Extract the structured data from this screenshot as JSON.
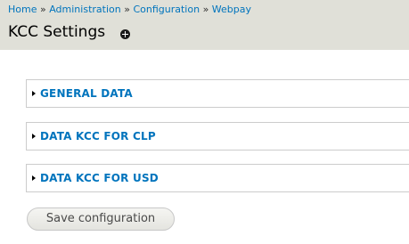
{
  "breadcrumb": {
    "items": [
      "Home",
      "Administration",
      "Configuration",
      "Webpay"
    ],
    "separator": "»"
  },
  "page_title": "KCC Settings",
  "shortcut_icon": "plus-circle-icon",
  "fieldsets": [
    {
      "label": "GENERAL DATA",
      "collapsed": true
    },
    {
      "label": "DATA KCC FOR CLP",
      "collapsed": true
    },
    {
      "label": "DATA KCC FOR USD",
      "collapsed": true
    }
  ],
  "actions": {
    "save_label": "Save configuration"
  },
  "colors": {
    "header_bg": "#e0e0d8",
    "link": "#0074bd",
    "fieldset_border": "#cccccc"
  }
}
